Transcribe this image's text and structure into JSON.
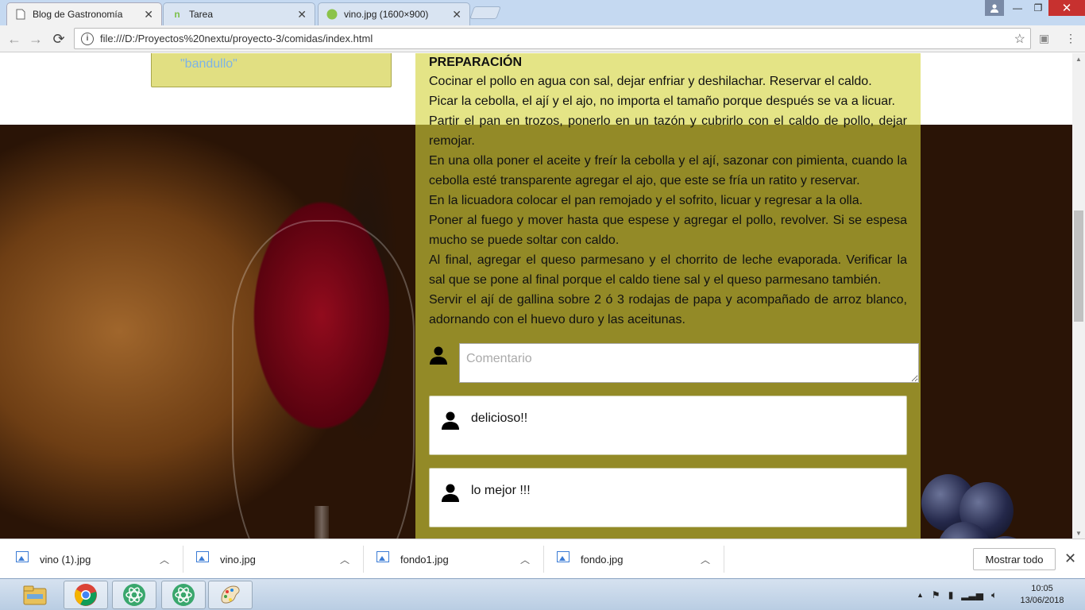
{
  "browser": {
    "tabs": [
      {
        "title": "Blog de Gastronomía",
        "icon": "page-icon",
        "active": true
      },
      {
        "title": "Tarea",
        "icon": "nextu-icon",
        "active": false
      },
      {
        "title": "vino.jpg (1600×900)",
        "icon": "image-tab-icon",
        "active": false
      }
    ],
    "address": "file:///D:/Proyectos%20nextu/proyecto-3/comidas/index.html"
  },
  "page": {
    "sidebar_link": "\"bandullo\"",
    "recipe": {
      "heading": "PREPARACIÓN",
      "steps": [
        "Cocinar el pollo en agua con sal, dejar enfriar y deshilachar. Reservar el caldo.",
        "Picar la cebolla, el ají y el ajo, no importa el tamaño porque después se va a licuar.",
        "Partir el pan en trozos, ponerlo en un tazón y cubrirlo con el caldo de pollo, dejar remojar.",
        "En una olla poner el aceite y freír la cebolla y el ají, sazonar con pimienta, cuando la cebolla esté transparente agregar el ajo, que este se fría un ratito y reservar.",
        "En la licuadora colocar el pan remojado y el sofrito, licuar y regresar a la olla.",
        "Poner al fuego y mover hasta que espese y agregar el pollo, revolver. Si se espesa mucho se puede soltar con caldo.",
        "Al final, agregar el queso parmesano y el chorrito de leche evaporada. Verificar la sal que se pone al final porque el caldo tiene sal y el queso parmesano también.",
        "Servir el ají de gallina sobre 2 ó 3 rodajas de papa y acompañado de arroz blanco, adornando con el huevo duro y las aceitunas."
      ]
    },
    "comment_placeholder": "Comentario",
    "comments": [
      "delicioso!!",
      "lo mejor !!!"
    ]
  },
  "downloads": {
    "files": [
      "vino (1).jpg",
      "vino.jpg",
      "fondo1.jpg",
      "fondo.jpg"
    ],
    "show_all": "Mostrar todo"
  },
  "taskbar": {
    "time": "10:05",
    "date": "13/06/2018"
  },
  "colors": {
    "content_panel": "#d4d43c",
    "sidebar_card": "#e1df82",
    "link": "#7db3e6"
  }
}
